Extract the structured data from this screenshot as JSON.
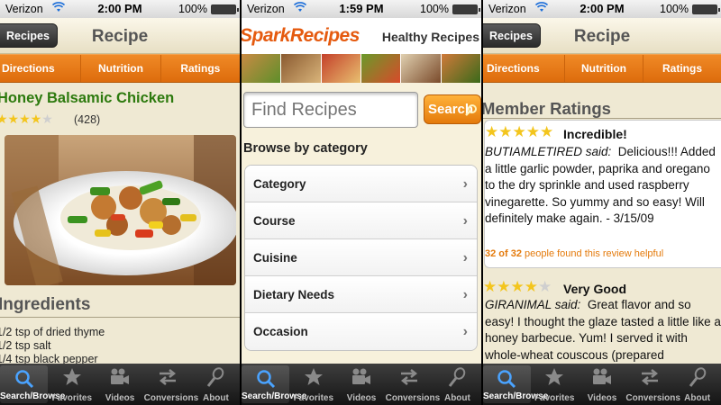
{
  "status": {
    "carrier": "Verizon",
    "battery": "100%",
    "times": [
      "2:00 PM",
      "1:59 PM",
      "2:00 PM"
    ]
  },
  "recipe": {
    "back_label": "Recipes",
    "nav_title": "Recipe",
    "tabs": [
      "Directions",
      "Nutrition",
      "Ratings"
    ],
    "title": "Honey Balsamic Chicken",
    "rating_count": "(428)",
    "stars_filled": 4,
    "ingredients_heading": "Ingredients",
    "ingredients": [
      "1/2 tsp of dried thyme",
      "1/2 tsp salt",
      "1/4 tsp black pepper"
    ]
  },
  "search": {
    "logo": "SparkRecipes",
    "tagline": "Healthy Recipes",
    "placeholder": "Find Recipes",
    "button": "Search",
    "browse_heading": "Browse by category",
    "categories": [
      "Category",
      "Course",
      "Cuisine",
      "Dietary Needs",
      "Occasion"
    ]
  },
  "ratings": {
    "heading": "Member Ratings",
    "reviews": [
      {
        "stars": 5,
        "title": "Incredible!",
        "author": "BUTIAMLETIRED said:",
        "text": "Delicious!!! Added a little garlic powder, paprika and oregano to the dry sprinkle and used raspberry vinegarette. So yummy and so easy! Will definitely make again. - 3/15/09",
        "helpful_count": "32 of 32",
        "helpful_text": "people found this review helpful"
      },
      {
        "stars": 4,
        "title": "Very Good",
        "author": "GIRANIMAL said:",
        "text": "Great flavor and so easy! I thought the glaze tasted a little like a honey barbecue. Yum! I served it with whole-wheat couscous (prepared"
      }
    ]
  },
  "tabbar": [
    "Search/Browse",
    "Favorites",
    "Videos",
    "Conversions",
    "About"
  ],
  "colors": {
    "accent_orange": "#e67914",
    "title_green": "#2d7a0e",
    "star_gold": "#f3c51d"
  }
}
